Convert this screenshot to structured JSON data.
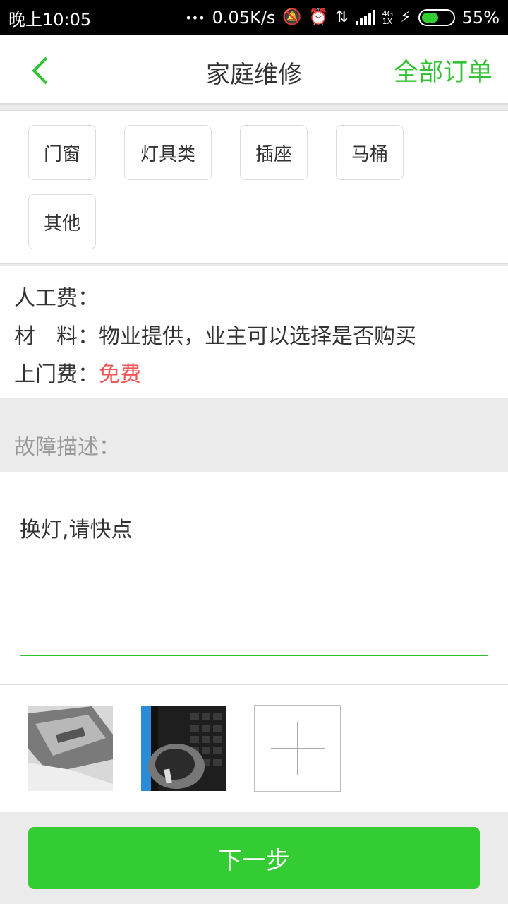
{
  "status_bar": {
    "time": "晚上10:05",
    "dots": "•••",
    "net_speed": "0.05K/s",
    "net_type_top": "4G",
    "net_type_bottom": "1X",
    "battery_percent_label": "55%",
    "battery_level": 0.55,
    "icons": [
      "mute-icon",
      "alarm-icon",
      "data-transfer-icon",
      "signal-icon",
      "charging-icon",
      "battery-icon"
    ]
  },
  "header": {
    "back_icon": "chevron-left-icon",
    "title": "家庭维修",
    "all_orders": "全部订单"
  },
  "categories": [
    "门窗",
    "灯具类",
    "插座",
    "马桶",
    "其他"
  ],
  "fees": {
    "labor_label": "人工费：",
    "material_label": "材　料：",
    "material_value": "物业提供，业主可以选择是否购买",
    "visit_label": "上门费：",
    "visit_value": "免费"
  },
  "fault": {
    "label": "故障描述：",
    "text": "换灯,请快点"
  },
  "photos": {
    "items": [
      "photo-thumbnail-1",
      "photo-thumbnail-2"
    ],
    "add_icon": "plus-icon"
  },
  "colors": {
    "accent": "#33cc33",
    "free": "#ee5555",
    "background": "#ebebeb"
  },
  "next_button": "下一步"
}
